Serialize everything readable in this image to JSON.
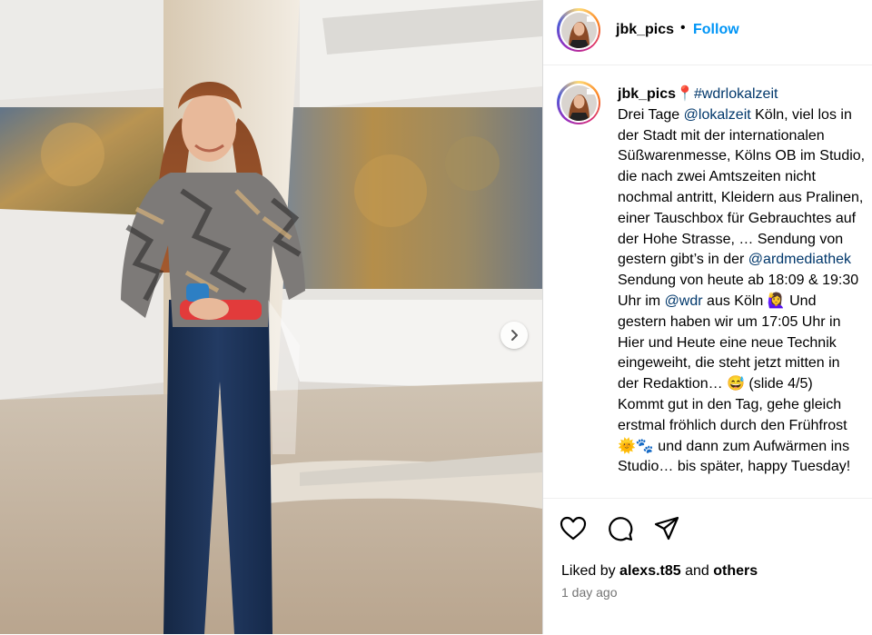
{
  "post": {
    "username": "jbk_pics",
    "separator": "•",
    "follow_label": "Follow",
    "caption_lines": [
      {
        "parts": [
          {
            "t": "Drei Tage ",
            "link": false
          },
          {
            "t": "@lokalzeit",
            "link": true
          },
          {
            "t": " Köln, viel los in",
            "link": false
          }
        ]
      },
      {
        "parts": [
          {
            "t": "der Stadt mit der internationalen",
            "link": false
          }
        ]
      },
      {
        "parts": [
          {
            "t": "Süßwarenmesse, Kölns OB im Studio,",
            "link": false
          }
        ]
      },
      {
        "parts": [
          {
            "t": "die nach zwei Amtszeiten nicht",
            "link": false
          }
        ]
      },
      {
        "parts": [
          {
            "t": "nochmal antritt, Kleidern aus Pralinen,",
            "link": false
          }
        ]
      },
      {
        "parts": [
          {
            "t": "einer Tauschbox für Gebrauchtes auf",
            "link": false
          }
        ]
      },
      {
        "parts": [
          {
            "t": "der Hohe Strasse, … Sendung von",
            "link": false
          }
        ]
      },
      {
        "parts": [
          {
            "t": "gestern gibt’s in der ",
            "link": false
          },
          {
            "t": "@ardmediathek",
            "link": true
          }
        ]
      },
      {
        "parts": [
          {
            "t": "Sendung von heute ab 18:09 & 19:30",
            "link": false
          }
        ]
      },
      {
        "parts": [
          {
            "t": "Uhr im ",
            "link": false
          },
          {
            "t": "@wdr",
            "link": true
          },
          {
            "t": " aus Köln 🙋‍♀️ Und",
            "link": false
          }
        ]
      },
      {
        "parts": [
          {
            "t": "gestern haben wir um 17:05 Uhr in",
            "link": false
          }
        ]
      },
      {
        "parts": [
          {
            "t": "Hier und Heute eine neue Technik",
            "link": false
          }
        ]
      },
      {
        "parts": [
          {
            "t": "eingeweiht, die steht jetzt mitten in",
            "link": false
          }
        ]
      },
      {
        "parts": [
          {
            "t": "der Redaktion… 😅 (slide 4/5)",
            "link": false
          }
        ]
      },
      {
        "parts": [
          {
            "t": "Kommt gut in den Tag, gehe gleich",
            "link": false
          }
        ]
      },
      {
        "parts": [
          {
            "t": "erstmal fröhlich durch den Frühfrost",
            "link": false
          }
        ]
      },
      {
        "parts": [
          {
            "t": "🌞🐾 und dann zum Aufwärmen ins",
            "link": false
          }
        ]
      },
      {
        "parts": [
          {
            "t": "Studio… bis später, happy Tuesday!",
            "link": false
          }
        ]
      }
    ],
    "caption_first_prefix": "📍",
    "caption_hashtag": "#wdrlokalzeit",
    "liked_by_prefix": "Liked by ",
    "liked_by_user": "alexs.t85",
    "liked_by_and": " and ",
    "liked_by_others": "others",
    "time_ago": "1 day ago",
    "icons": {
      "like": "heart-icon",
      "comment": "comment-icon",
      "share": "share-icon",
      "next": "chevron-right-icon"
    }
  }
}
